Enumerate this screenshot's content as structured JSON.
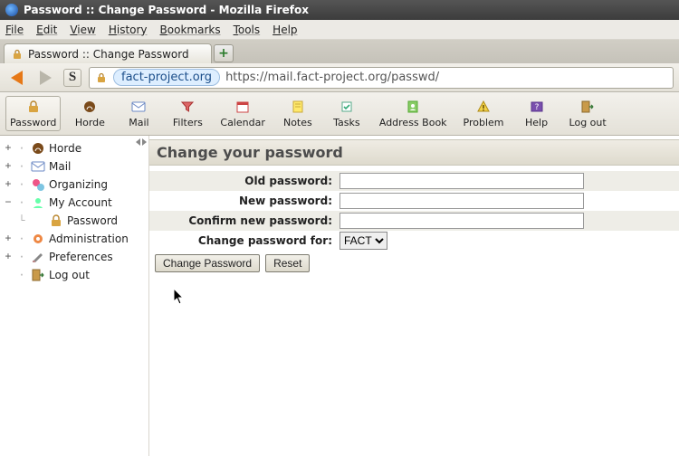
{
  "os": {
    "title": "Password :: Change Password - Mozilla Firefox"
  },
  "menubar": [
    "File",
    "Edit",
    "View",
    "History",
    "Bookmarks",
    "Tools",
    "Help"
  ],
  "tab": {
    "label": "Password :: Change Password"
  },
  "urlbar": {
    "host_pill": "fact-project.org",
    "rest": "https://mail.fact-project.org/passwd/"
  },
  "toolbar": [
    {
      "id": "password",
      "label": "Password",
      "icon": "lock-icon",
      "active": true
    },
    {
      "id": "horde",
      "label": "Horde",
      "icon": "horde-icon"
    },
    {
      "id": "mail",
      "label": "Mail",
      "icon": "mail-icon"
    },
    {
      "id": "filters",
      "label": "Filters",
      "icon": "funnel-icon"
    },
    {
      "id": "calendar",
      "label": "Calendar",
      "icon": "calendar-icon"
    },
    {
      "id": "notes",
      "label": "Notes",
      "icon": "notes-icon"
    },
    {
      "id": "tasks",
      "label": "Tasks",
      "icon": "tasks-icon"
    },
    {
      "id": "addressbook",
      "label": "Address Book",
      "icon": "addressbook-icon"
    },
    {
      "id": "problem",
      "label": "Problem",
      "icon": "problem-icon"
    },
    {
      "id": "help",
      "label": "Help",
      "icon": "help-icon"
    },
    {
      "id": "logout",
      "label": "Log out",
      "icon": "logout-icon"
    }
  ],
  "sidebar": [
    {
      "exp": "+",
      "icon": "horde-icon",
      "label": "Horde"
    },
    {
      "exp": "+",
      "icon": "mail-icon",
      "label": "Mail"
    },
    {
      "exp": "+",
      "icon": "organizing-icon",
      "label": "Organizing"
    },
    {
      "exp": "−",
      "icon": "account-icon",
      "label": "My Account",
      "children": [
        {
          "icon": "lock-icon",
          "label": "Password"
        }
      ]
    },
    {
      "exp": "+",
      "icon": "admin-icon",
      "label": "Administration"
    },
    {
      "exp": "+",
      "icon": "prefs-icon",
      "label": "Preferences"
    },
    {
      "exp": "",
      "icon": "logout-icon",
      "label": "Log out"
    }
  ],
  "page": {
    "heading": "Change your password",
    "fields": {
      "old_label": "Old password:",
      "new_label": "New password:",
      "confirm_label": "Confirm new password:",
      "for_label": "Change password for:",
      "for_value": "FACT"
    },
    "buttons": {
      "submit": "Change Password",
      "reset": "Reset"
    }
  }
}
